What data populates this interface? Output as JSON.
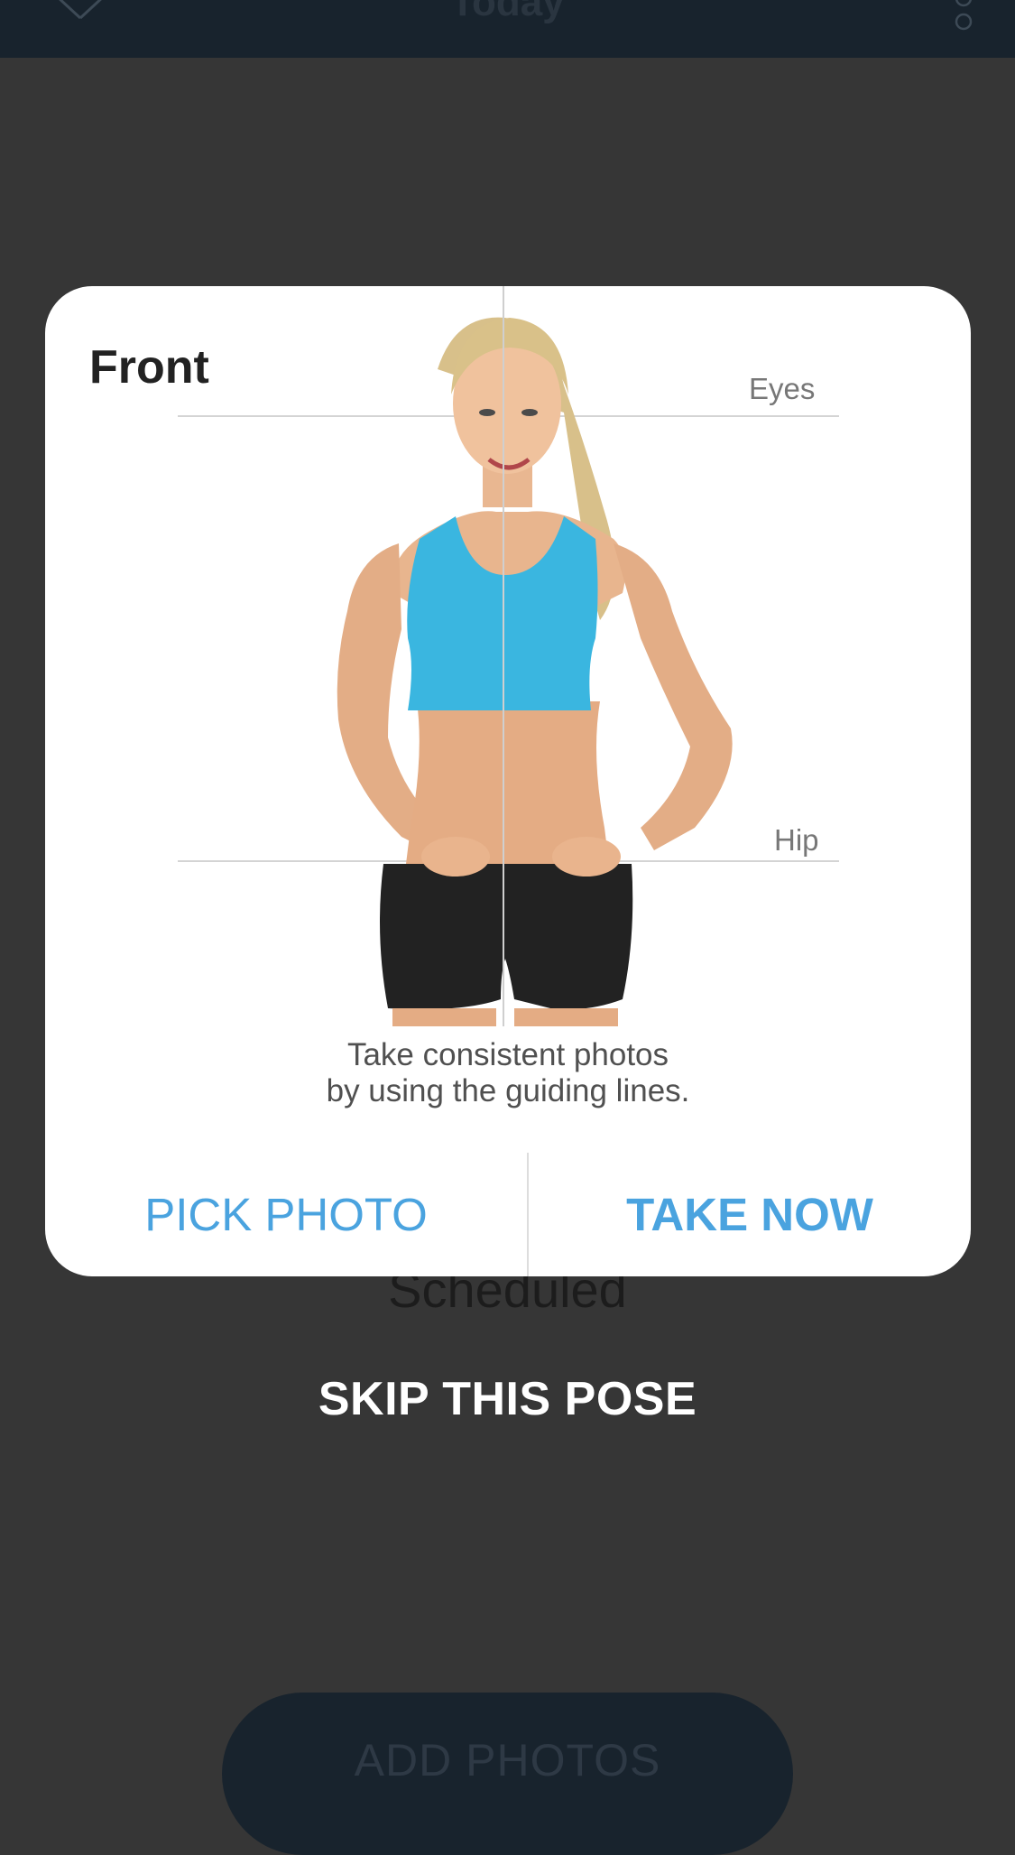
{
  "app_bar": {
    "title": "Today",
    "close_icon": "close-icon",
    "more_icon": "more-vertical-icon"
  },
  "background": {
    "scheduled_label": "Scheduled",
    "skip_label": "SKIP THIS POSE",
    "add_photos_label": "ADD PHOTOS"
  },
  "dialog": {
    "title": "Front",
    "guides": {
      "eyes_label": "Eyes",
      "hip_label": "Hip"
    },
    "illustration": "woman-front-pose-photo",
    "instructions": [
      "Take consistent photos",
      "by using the guiding lines."
    ],
    "pick_photo_label": "PICK PHOTO",
    "take_now_label": "TAKE NOW"
  },
  "colors": {
    "accent": "#4aa3df",
    "app_bar": "#18232d",
    "overlay": "#363636",
    "top_color": "#3ab6e0"
  }
}
